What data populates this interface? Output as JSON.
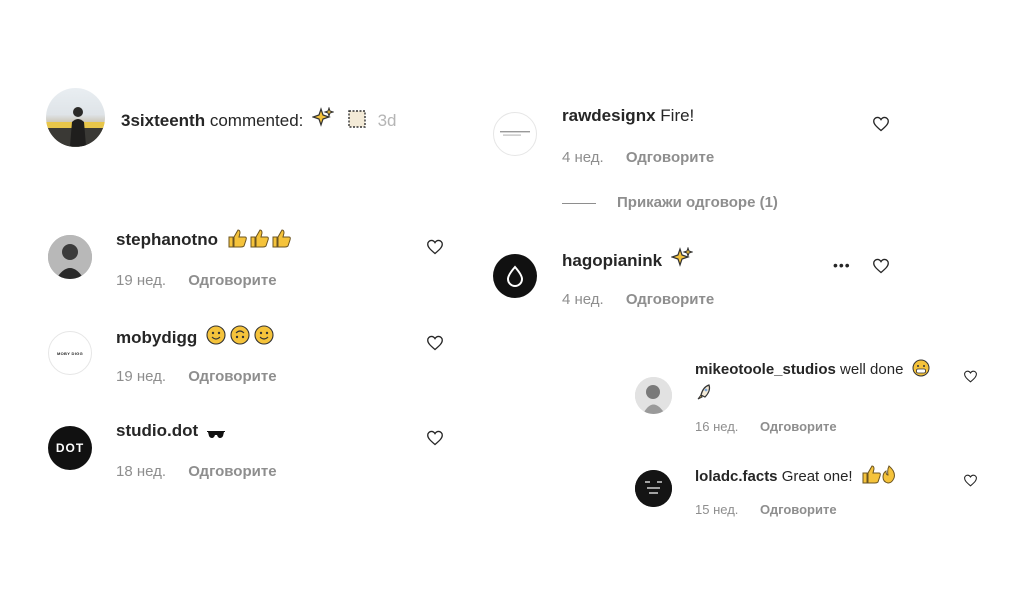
{
  "top_comment": {
    "username": "3sixteenth",
    "label": "commented:",
    "time": "3d"
  },
  "left_comments": [
    {
      "username": "stephanotno",
      "time": "19 нед.",
      "reply": "Одговорите"
    },
    {
      "username": "mobydigg",
      "time": "19 нед.",
      "reply": "Одговорите",
      "avatar_text": "MOBY DIGG"
    },
    {
      "username": "studio.dot",
      "time": "18 нед.",
      "reply": "Одговорите",
      "avatar_text": "DOT"
    }
  ],
  "right_comments": [
    {
      "username": "rawdesignx",
      "text": "Fire!",
      "time": "4 нед.",
      "reply": "Одговорите"
    },
    {
      "username": "hagopianink",
      "time": "4 нед.",
      "reply": "Одговорите"
    }
  ],
  "view_replies": "Прикажи одговоре (1)",
  "replies": [
    {
      "username": "mikeotoole_studios",
      "text": "well done",
      "time": "16 нед.",
      "reply": "Одговорите"
    },
    {
      "username": "loladc.facts",
      "text": "Great one!",
      "time": "15 нед.",
      "reply": "Одговорите"
    }
  ],
  "more_label": "•••",
  "colors": {
    "emoji": "#f5c33b",
    "muted": "#8e8e8e",
    "text": "#262626"
  }
}
